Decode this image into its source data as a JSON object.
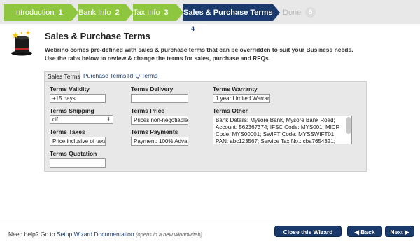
{
  "wizard": {
    "steps": [
      {
        "label": "Introduction",
        "num": "1"
      },
      {
        "label": "Bank Info",
        "num": "2"
      },
      {
        "label": "Tax Info",
        "num": "3"
      },
      {
        "label": "Sales & Purchase Terms",
        "num": "4"
      },
      {
        "label": "Done",
        "num": "5"
      }
    ],
    "colors": {
      "done": "#8ec63f",
      "active": "#1a3a6b",
      "todo_bg": "#e8e8e8"
    }
  },
  "header": {
    "title": "Sales & Purchase Terms",
    "description_line1": "Webrino comes pre-defined with sales & purchase terms that can be overridden to suit your Business needs.",
    "description_line2": "Use the tabs below to review & change the terms for sales, purchase and RFQs."
  },
  "tabs": [
    {
      "label": "Sales Terms",
      "active": true
    },
    {
      "label": "Purchase Terms",
      "active": false
    },
    {
      "label": "RFQ Terms",
      "active": false
    }
  ],
  "form": {
    "validity": {
      "label": "Terms Validity",
      "value": "+15 days"
    },
    "delivery": {
      "label": "Terms Delivery",
      "value": ""
    },
    "warranty": {
      "label": "Terms Warranty",
      "value": "1 year Limited Warran"
    },
    "shipping": {
      "label": "Terms Shipping",
      "value": "cif"
    },
    "price": {
      "label": "Terms Price",
      "value": "Prices non-negotiable"
    },
    "other": {
      "label": "Terms Other",
      "value": "Bank Details: Mysore Bank, Mysore Bank Road; Account: 562367374; IFSC Code: MYS001; MICR Code: MYS00001; SWIFT Code: MYSSWIFT01; PAN: abc123567; Service Tax No.: cba7654321; TIN: zyx987654"
    },
    "taxes": {
      "label": "Terms Taxes",
      "value": "Price inclusive of taxe"
    },
    "payments": {
      "label": "Terms Payments",
      "value": "Payment: 100% Advan"
    },
    "quotation": {
      "label": "Terms Quotation",
      "value": ""
    }
  },
  "footer": {
    "help_prefix": "Need help? Go to ",
    "help_link": "Setup Wizard Documentation",
    "help_note": "(opens in a new window/tab)",
    "close_label": "Close this Wizard",
    "back_label": "Back",
    "next_label": "Next"
  }
}
